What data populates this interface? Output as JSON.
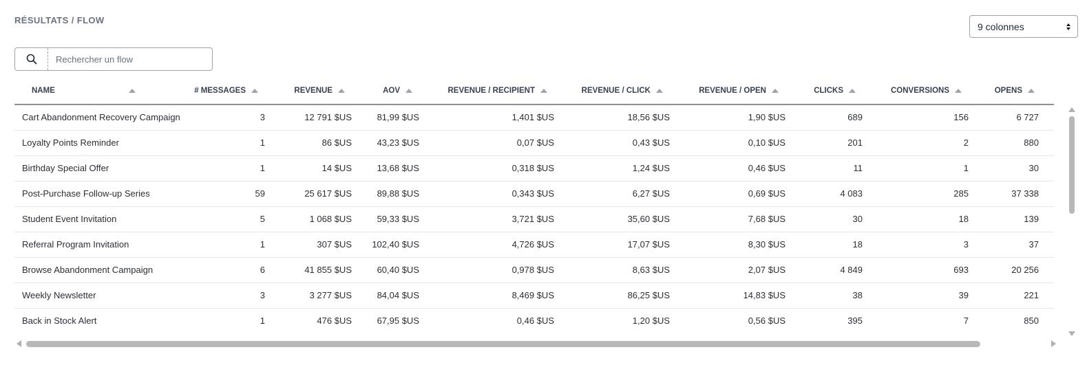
{
  "breadcrumb": "RÉSULTATS / FLOW",
  "column_selector": {
    "value": "9 colonnes"
  },
  "search": {
    "placeholder": "Rechercher un flow",
    "value": ""
  },
  "table": {
    "headers": [
      "NAME",
      "# MESSAGES",
      "REVENUE",
      "AOV",
      "REVENUE / RECIPIENT",
      "REVENUE / CLICK",
      "REVENUE / OPEN",
      "CLICKS",
      "CONVERSIONS",
      "OPENS"
    ],
    "rows": [
      [
        "Cart Abandonment Recovery Campaign",
        "3",
        "12 791 $US",
        "81,99 $US",
        "1,401 $US",
        "18,56 $US",
        "1,90 $US",
        "689",
        "156",
        "6 727"
      ],
      [
        "Loyalty Points Reminder",
        "1",
        "86 $US",
        "43,23 $US",
        "0,07 $US",
        "0,43 $US",
        "0,10 $US",
        "201",
        "2",
        "880"
      ],
      [
        "Birthday Special Offer",
        "1",
        "14 $US",
        "13,68 $US",
        "0,318 $US",
        "1,24 $US",
        "0,46 $US",
        "11",
        "1",
        "30"
      ],
      [
        "Post-Purchase Follow-up Series",
        "59",
        "25 617 $US",
        "89,88 $US",
        "0,343 $US",
        "6,27 $US",
        "0,69 $US",
        "4 083",
        "285",
        "37 338"
      ],
      [
        "Student Event Invitation",
        "5",
        "1 068 $US",
        "59,33 $US",
        "3,721 $US",
        "35,60 $US",
        "7,68 $US",
        "30",
        "18",
        "139"
      ],
      [
        "Referral Program Invitation",
        "1",
        "307 $US",
        "102,40 $US",
        "4,726 $US",
        "17,07 $US",
        "8,30 $US",
        "18",
        "3",
        "37"
      ],
      [
        "Browse Abandonment Campaign",
        "6",
        "41 855 $US",
        "60,40 $US",
        "0,978 $US",
        "8,63 $US",
        "2,07 $US",
        "4 849",
        "693",
        "20 256"
      ],
      [
        "Weekly Newsletter",
        "3",
        "3 277 $US",
        "84,04 $US",
        "8,469 $US",
        "86,25 $US",
        "14,83 $US",
        "38",
        "39",
        "221"
      ],
      [
        "Back in Stock Alert",
        "1",
        "476 $US",
        "67,95 $US",
        "0,46 $US",
        "1,20 $US",
        "0,56 $US",
        "395",
        "7",
        "850"
      ]
    ]
  }
}
